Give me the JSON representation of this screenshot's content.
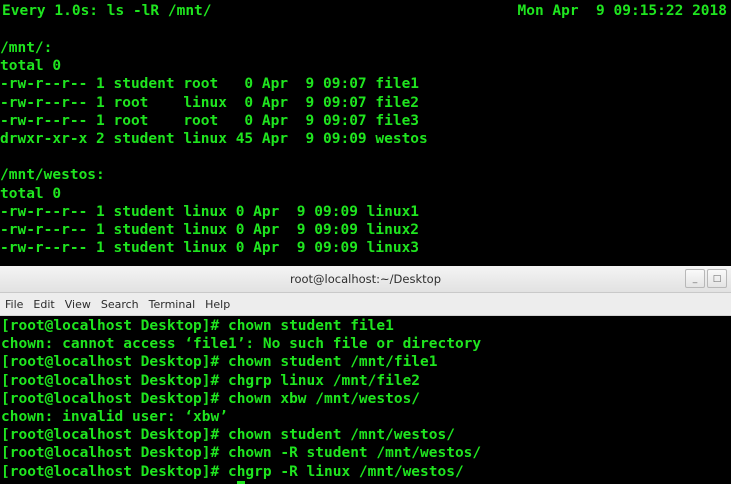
{
  "watch": {
    "header_left": "Every 1.0s: ls -lR /mnt/",
    "header_right": "Mon Apr  9 09:15:22 2018",
    "lines": [
      "/mnt/:",
      "total 0",
      "-rw-r--r-- 1 student root   0 Apr  9 09:07 file1",
      "-rw-r--r-- 1 root    linux  0 Apr  9 09:07 file2",
      "-rw-r--r-- 1 root    root   0 Apr  9 09:07 file3",
      "drwxr-xr-x 2 student linux 45 Apr  9 09:09 westos",
      "",
      "/mnt/westos:",
      "total 0",
      "-rw-r--r-- 1 student linux 0 Apr  9 09:09 linux1",
      "-rw-r--r-- 1 student linux 0 Apr  9 09:09 linux2",
      "-rw-r--r-- 1 student linux 0 Apr  9 09:09 linux3"
    ]
  },
  "window": {
    "title": "root@localhost:~/Desktop",
    "minimize_label": "_",
    "maximize_label": "□",
    "menu": [
      "File",
      "Edit",
      "View",
      "Search",
      "Terminal",
      "Help"
    ]
  },
  "terminal": {
    "lines": [
      "[root@localhost Desktop]# chown student file1",
      "chown: cannot access ‘file1’: No such file or directory",
      "[root@localhost Desktop]# chown student /mnt/file1",
      "[root@localhost Desktop]# chgrp linux /mnt/file2",
      "[root@localhost Desktop]# chown xbw /mnt/westos/",
      "chown: invalid user: ‘xbw’",
      "[root@localhost Desktop]# chown student /mnt/westos/",
      "[root@localhost Desktop]# chown -R student /mnt/westos/",
      "[root@localhost Desktop]# chgrp -R linux /mnt/westos/"
    ]
  },
  "colors": {
    "terminal_text": "#1fe51f",
    "terminal_bg": "#000000"
  }
}
